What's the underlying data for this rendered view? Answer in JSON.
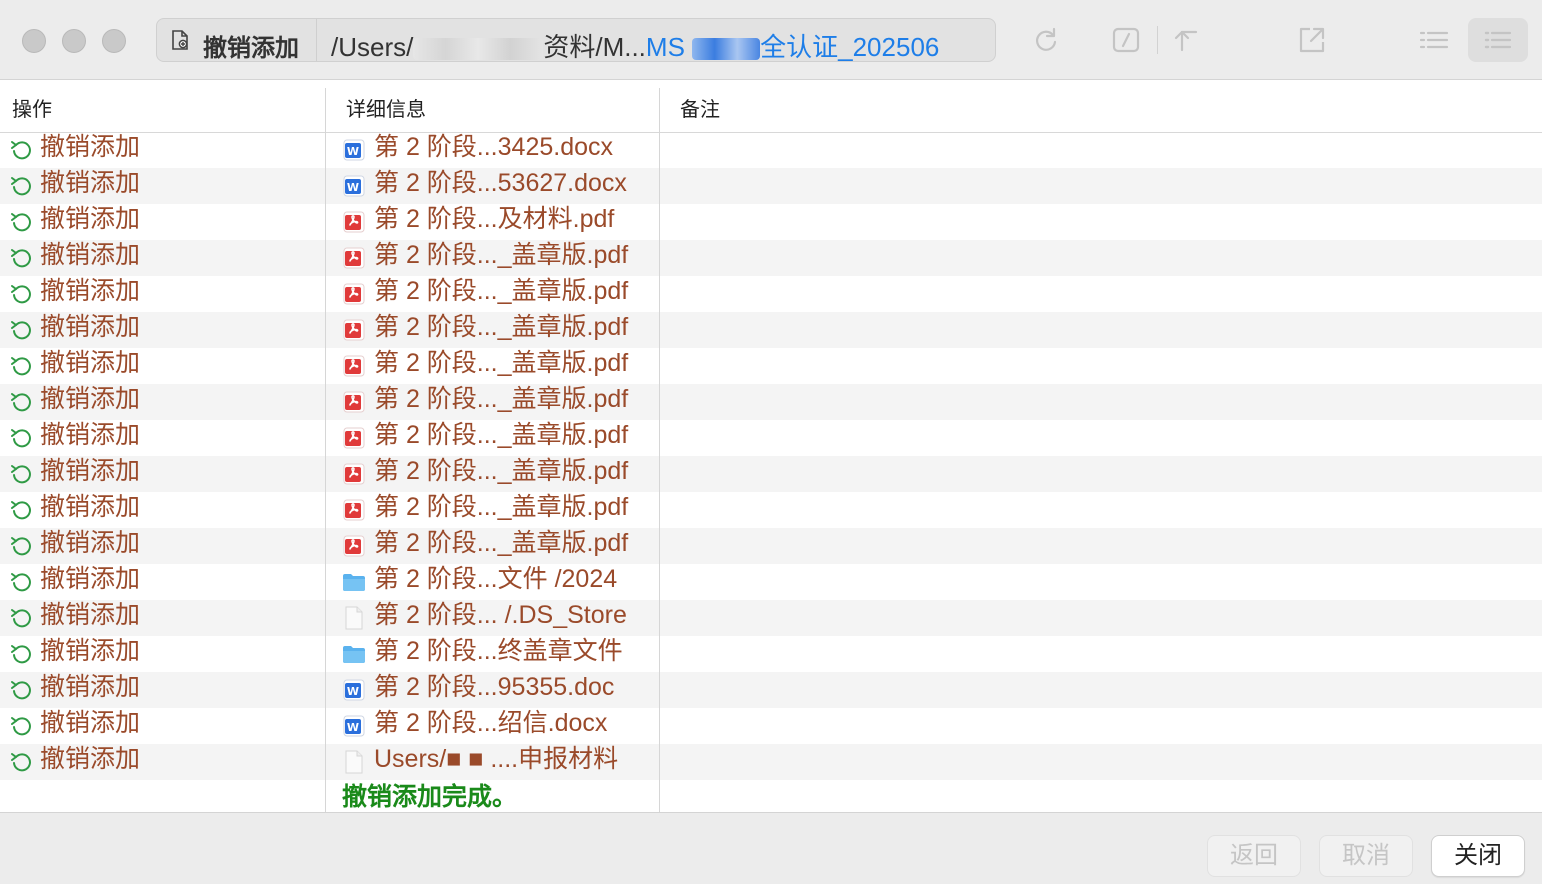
{
  "toolbar": {
    "command_label": "撤销添加",
    "path_prefix": "/Users/",
    "path_middle": "资料/M...",
    "path_accent_start": "MS",
    "path_accent_end": "全认证_202506"
  },
  "columns": {
    "operation": "操作",
    "detail": "详细信息",
    "remark": "备注"
  },
  "rows": [
    {
      "op": "撤销添加",
      "icon": "word-doc-icon",
      "detail": "第 2 阶段...3425.docx"
    },
    {
      "op": "撤销添加",
      "icon": "word-doc-icon",
      "detail": "第 2 阶段...53627.docx"
    },
    {
      "op": "撤销添加",
      "icon": "pdf-icon",
      "detail": "第 2 阶段...及材料.pdf"
    },
    {
      "op": "撤销添加",
      "icon": "pdf-icon",
      "detail": "第 2 阶段..._盖章版.pdf"
    },
    {
      "op": "撤销添加",
      "icon": "pdf-icon",
      "detail": "第 2 阶段..._盖章版.pdf"
    },
    {
      "op": "撤销添加",
      "icon": "pdf-icon",
      "detail": "第 2 阶段..._盖章版.pdf"
    },
    {
      "op": "撤销添加",
      "icon": "pdf-icon",
      "detail": "第 2 阶段..._盖章版.pdf"
    },
    {
      "op": "撤销添加",
      "icon": "pdf-icon",
      "detail": "第 2 阶段..._盖章版.pdf"
    },
    {
      "op": "撤销添加",
      "icon": "pdf-icon",
      "detail": "第 2 阶段..._盖章版.pdf"
    },
    {
      "op": "撤销添加",
      "icon": "pdf-icon",
      "detail": "第 2 阶段..._盖章版.pdf"
    },
    {
      "op": "撤销添加",
      "icon": "pdf-icon",
      "detail": "第 2 阶段..._盖章版.pdf"
    },
    {
      "op": "撤销添加",
      "icon": "pdf-icon",
      "detail": "第 2 阶段..._盖章版.pdf"
    },
    {
      "op": "撤销添加",
      "icon": "folder-icon",
      "detail": "第 2 阶段...文件 /2024"
    },
    {
      "op": "撤销添加",
      "icon": "generic-file-icon",
      "detail": "第 2 阶段... /.DS_Store"
    },
    {
      "op": "撤销添加",
      "icon": "folder-icon",
      "detail": "第 2 阶段...终盖章文件"
    },
    {
      "op": "撤销添加",
      "icon": "word-doc-icon",
      "detail": "第 2 阶段...95355.doc"
    },
    {
      "op": "撤销添加",
      "icon": "word-doc-icon",
      "detail": "第 2 阶段...绍信.docx"
    },
    {
      "op": "撤销添加",
      "icon": "generic-file-icon",
      "detail": "Users/■ ■ ....申报材料"
    }
  ],
  "status_message": "撤销添加完成。",
  "buttons": {
    "back": "返回",
    "cancel": "取消",
    "close": "关闭"
  },
  "colors": {
    "op_text": "#9a4a2a",
    "done_text": "#1a8a1a",
    "path_accent": "#1e7ee8",
    "undo_icon": "#2f9a45",
    "pdf_red": "#e03a3a",
    "word_blue": "#2b6fdc",
    "folder_blue": "#5ab2ee"
  }
}
